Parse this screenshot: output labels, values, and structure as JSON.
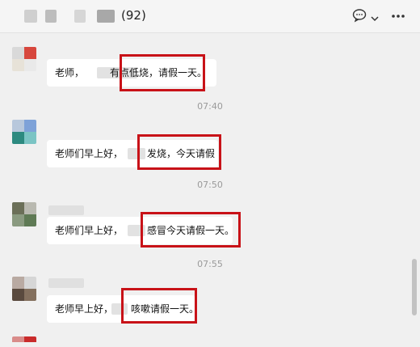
{
  "header": {
    "title_count": "(92)",
    "chat_icon": "chat-bubble-icon",
    "dropdown_icon": "chevron-down-icon",
    "more_icon": "more-icon"
  },
  "messages": [
    {
      "text_left": "老师，",
      "text_highlight": "有点低烧，请假一天。"
    },
    {
      "text_left": "老师们早上好，",
      "text_highlight": "发烧，今天请假"
    },
    {
      "text_left": "老师们早上好，",
      "text_highlight": "感冒今天请假一天。"
    },
    {
      "text_left": "老师早上好，",
      "text_highlight": "咳嗽请假一天。"
    }
  ],
  "timestamps": [
    "07:40",
    "07:50",
    "07:55"
  ],
  "colors": {
    "highlight": "#c81218",
    "bubble": "#ffffff",
    "background": "#f0f0f0"
  }
}
